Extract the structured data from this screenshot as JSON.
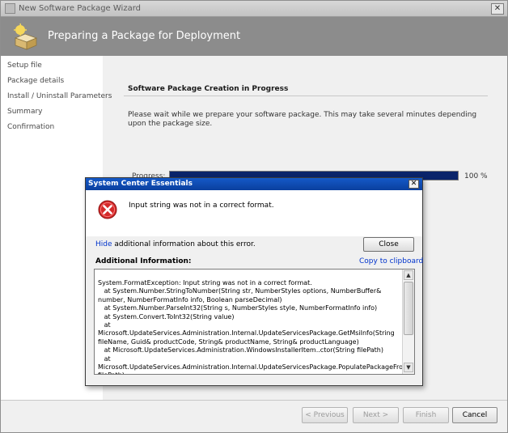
{
  "wizard": {
    "title": "New Software Package Wizard",
    "banner_title": "Preparing a Package for Deployment",
    "nav": [
      "Setup file",
      "Package details",
      "Install / Uninstall Parameters",
      "Summary",
      "Confirmation"
    ],
    "content_title": "Software Package Creation in Progress",
    "content_description": "Please wait while we prepare your software package.  This may take several minutes depending upon the package size.",
    "progress_label": "Progress:",
    "progress_value": 100,
    "progress_text": "100 %",
    "buttons": {
      "previous": "< Previous",
      "next": "Next >",
      "finish": "Finish",
      "cancel": "Cancel"
    }
  },
  "dialog": {
    "title": "System Center Essentials",
    "close_glyph": "✕",
    "message": "Input string was not in a correct format.",
    "hide_link": "Hide",
    "hide_suffix": " additional information about this error.",
    "close_button": "Close",
    "additional_info_label": "Additional Information:",
    "copy_link": "Copy to clipboard",
    "details": "System.FormatException: Input string was not in a correct format.\n   at System.Number.StringToNumber(String str, NumberStyles options, NumberBuffer& number, NumberFormatInfo info, Boolean parseDecimal)\n   at System.Number.ParseInt32(String s, NumberStyles style, NumberFormatInfo info)\n   at System.Convert.ToInt32(String value)\n   at Microsoft.UpdateServices.Administration.Internal.UpdateServicesPackage.GetMsiInfo(String fileName, Guid& productCode, String& productName, String& productLanguage)\n   at Microsoft.UpdateServices.Administration.WindowsInstallerItem..ctor(String filePath)\n   at Microsoft.UpdateServices.Administration.Internal.UpdateServicesPackage.PopulatePackageFromWindowsInstaller(String filePath)"
  },
  "icons": {
    "wizard": "wizard-icon",
    "banner": "software-package-icon",
    "error": "error-icon"
  },
  "colors": {
    "dialog_title": "#0a3f9e",
    "progress_fill": "#0a246a",
    "link": "#0033cc",
    "error_red": "#d42a2a"
  }
}
